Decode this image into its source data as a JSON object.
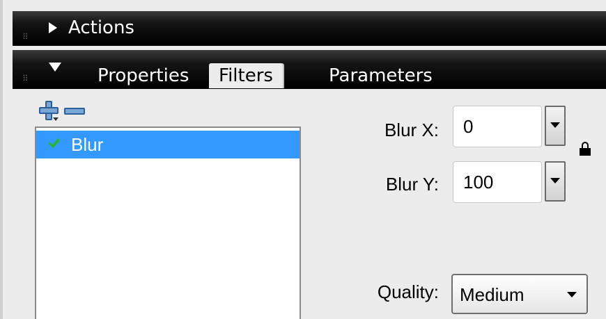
{
  "actions_panel": {
    "title": "Actions"
  },
  "properties_panel": {
    "tabs": [
      {
        "label": "Properties"
      },
      {
        "label": "Filters"
      },
      {
        "label": "Parameters"
      }
    ],
    "active_tab": "Filters"
  },
  "filter_list": {
    "items": [
      {
        "label": "Blur",
        "enabled": true,
        "selected": true
      }
    ]
  },
  "params": {
    "blur_x": {
      "label": "Blur X:",
      "value": "0"
    },
    "blur_y": {
      "label": "Blur Y:",
      "value": "100"
    },
    "quality": {
      "label": "Quality:",
      "value": "Medium"
    },
    "linked": false
  },
  "colors": {
    "selection": "#3399ff",
    "check": "#2db52d",
    "panel_bg": "#ececec",
    "header_bg": "#000000"
  }
}
